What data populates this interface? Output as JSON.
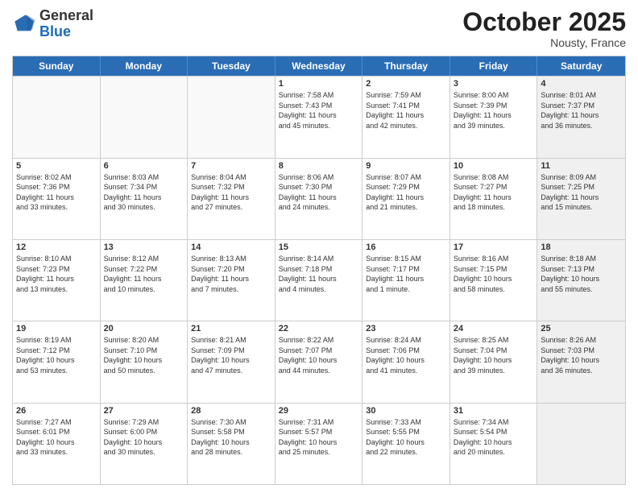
{
  "header": {
    "logo_general": "General",
    "logo_blue": "Blue",
    "month": "October 2025",
    "location": "Nousty, France"
  },
  "weekdays": [
    "Sunday",
    "Monday",
    "Tuesday",
    "Wednesday",
    "Thursday",
    "Friday",
    "Saturday"
  ],
  "weeks": [
    [
      {
        "day": "",
        "info": "",
        "empty": true
      },
      {
        "day": "",
        "info": "",
        "empty": true
      },
      {
        "day": "",
        "info": "",
        "empty": true
      },
      {
        "day": "1",
        "info": "Sunrise: 7:58 AM\nSunset: 7:43 PM\nDaylight: 11 hours\nand 45 minutes."
      },
      {
        "day": "2",
        "info": "Sunrise: 7:59 AM\nSunset: 7:41 PM\nDaylight: 11 hours\nand 42 minutes."
      },
      {
        "day": "3",
        "info": "Sunrise: 8:00 AM\nSunset: 7:39 PM\nDaylight: 11 hours\nand 39 minutes."
      },
      {
        "day": "4",
        "info": "Sunrise: 8:01 AM\nSunset: 7:37 PM\nDaylight: 11 hours\nand 36 minutes.",
        "shaded": true
      }
    ],
    [
      {
        "day": "5",
        "info": "Sunrise: 8:02 AM\nSunset: 7:36 PM\nDaylight: 11 hours\nand 33 minutes."
      },
      {
        "day": "6",
        "info": "Sunrise: 8:03 AM\nSunset: 7:34 PM\nDaylight: 11 hours\nand 30 minutes."
      },
      {
        "day": "7",
        "info": "Sunrise: 8:04 AM\nSunset: 7:32 PM\nDaylight: 11 hours\nand 27 minutes."
      },
      {
        "day": "8",
        "info": "Sunrise: 8:06 AM\nSunset: 7:30 PM\nDaylight: 11 hours\nand 24 minutes."
      },
      {
        "day": "9",
        "info": "Sunrise: 8:07 AM\nSunset: 7:29 PM\nDaylight: 11 hours\nand 21 minutes."
      },
      {
        "day": "10",
        "info": "Sunrise: 8:08 AM\nSunset: 7:27 PM\nDaylight: 11 hours\nand 18 minutes."
      },
      {
        "day": "11",
        "info": "Sunrise: 8:09 AM\nSunset: 7:25 PM\nDaylight: 11 hours\nand 15 minutes.",
        "shaded": true
      }
    ],
    [
      {
        "day": "12",
        "info": "Sunrise: 8:10 AM\nSunset: 7:23 PM\nDaylight: 11 hours\nand 13 minutes."
      },
      {
        "day": "13",
        "info": "Sunrise: 8:12 AM\nSunset: 7:22 PM\nDaylight: 11 hours\nand 10 minutes."
      },
      {
        "day": "14",
        "info": "Sunrise: 8:13 AM\nSunset: 7:20 PM\nDaylight: 11 hours\nand 7 minutes."
      },
      {
        "day": "15",
        "info": "Sunrise: 8:14 AM\nSunset: 7:18 PM\nDaylight: 11 hours\nand 4 minutes."
      },
      {
        "day": "16",
        "info": "Sunrise: 8:15 AM\nSunset: 7:17 PM\nDaylight: 11 hours\nand 1 minute."
      },
      {
        "day": "17",
        "info": "Sunrise: 8:16 AM\nSunset: 7:15 PM\nDaylight: 10 hours\nand 58 minutes."
      },
      {
        "day": "18",
        "info": "Sunrise: 8:18 AM\nSunset: 7:13 PM\nDaylight: 10 hours\nand 55 minutes.",
        "shaded": true
      }
    ],
    [
      {
        "day": "19",
        "info": "Sunrise: 8:19 AM\nSunset: 7:12 PM\nDaylight: 10 hours\nand 53 minutes."
      },
      {
        "day": "20",
        "info": "Sunrise: 8:20 AM\nSunset: 7:10 PM\nDaylight: 10 hours\nand 50 minutes."
      },
      {
        "day": "21",
        "info": "Sunrise: 8:21 AM\nSunset: 7:09 PM\nDaylight: 10 hours\nand 47 minutes."
      },
      {
        "day": "22",
        "info": "Sunrise: 8:22 AM\nSunset: 7:07 PM\nDaylight: 10 hours\nand 44 minutes."
      },
      {
        "day": "23",
        "info": "Sunrise: 8:24 AM\nSunset: 7:06 PM\nDaylight: 10 hours\nand 41 minutes."
      },
      {
        "day": "24",
        "info": "Sunrise: 8:25 AM\nSunset: 7:04 PM\nDaylight: 10 hours\nand 39 minutes."
      },
      {
        "day": "25",
        "info": "Sunrise: 8:26 AM\nSunset: 7:03 PM\nDaylight: 10 hours\nand 36 minutes.",
        "shaded": true
      }
    ],
    [
      {
        "day": "26",
        "info": "Sunrise: 7:27 AM\nSunset: 6:01 PM\nDaylight: 10 hours\nand 33 minutes."
      },
      {
        "day": "27",
        "info": "Sunrise: 7:29 AM\nSunset: 6:00 PM\nDaylight: 10 hours\nand 30 minutes."
      },
      {
        "day": "28",
        "info": "Sunrise: 7:30 AM\nSunset: 5:58 PM\nDaylight: 10 hours\nand 28 minutes."
      },
      {
        "day": "29",
        "info": "Sunrise: 7:31 AM\nSunset: 5:57 PM\nDaylight: 10 hours\nand 25 minutes."
      },
      {
        "day": "30",
        "info": "Sunrise: 7:33 AM\nSunset: 5:55 PM\nDaylight: 10 hours\nand 22 minutes."
      },
      {
        "day": "31",
        "info": "Sunrise: 7:34 AM\nSunset: 5:54 PM\nDaylight: 10 hours\nand 20 minutes."
      },
      {
        "day": "",
        "info": "",
        "empty": true,
        "shaded": true
      }
    ]
  ]
}
